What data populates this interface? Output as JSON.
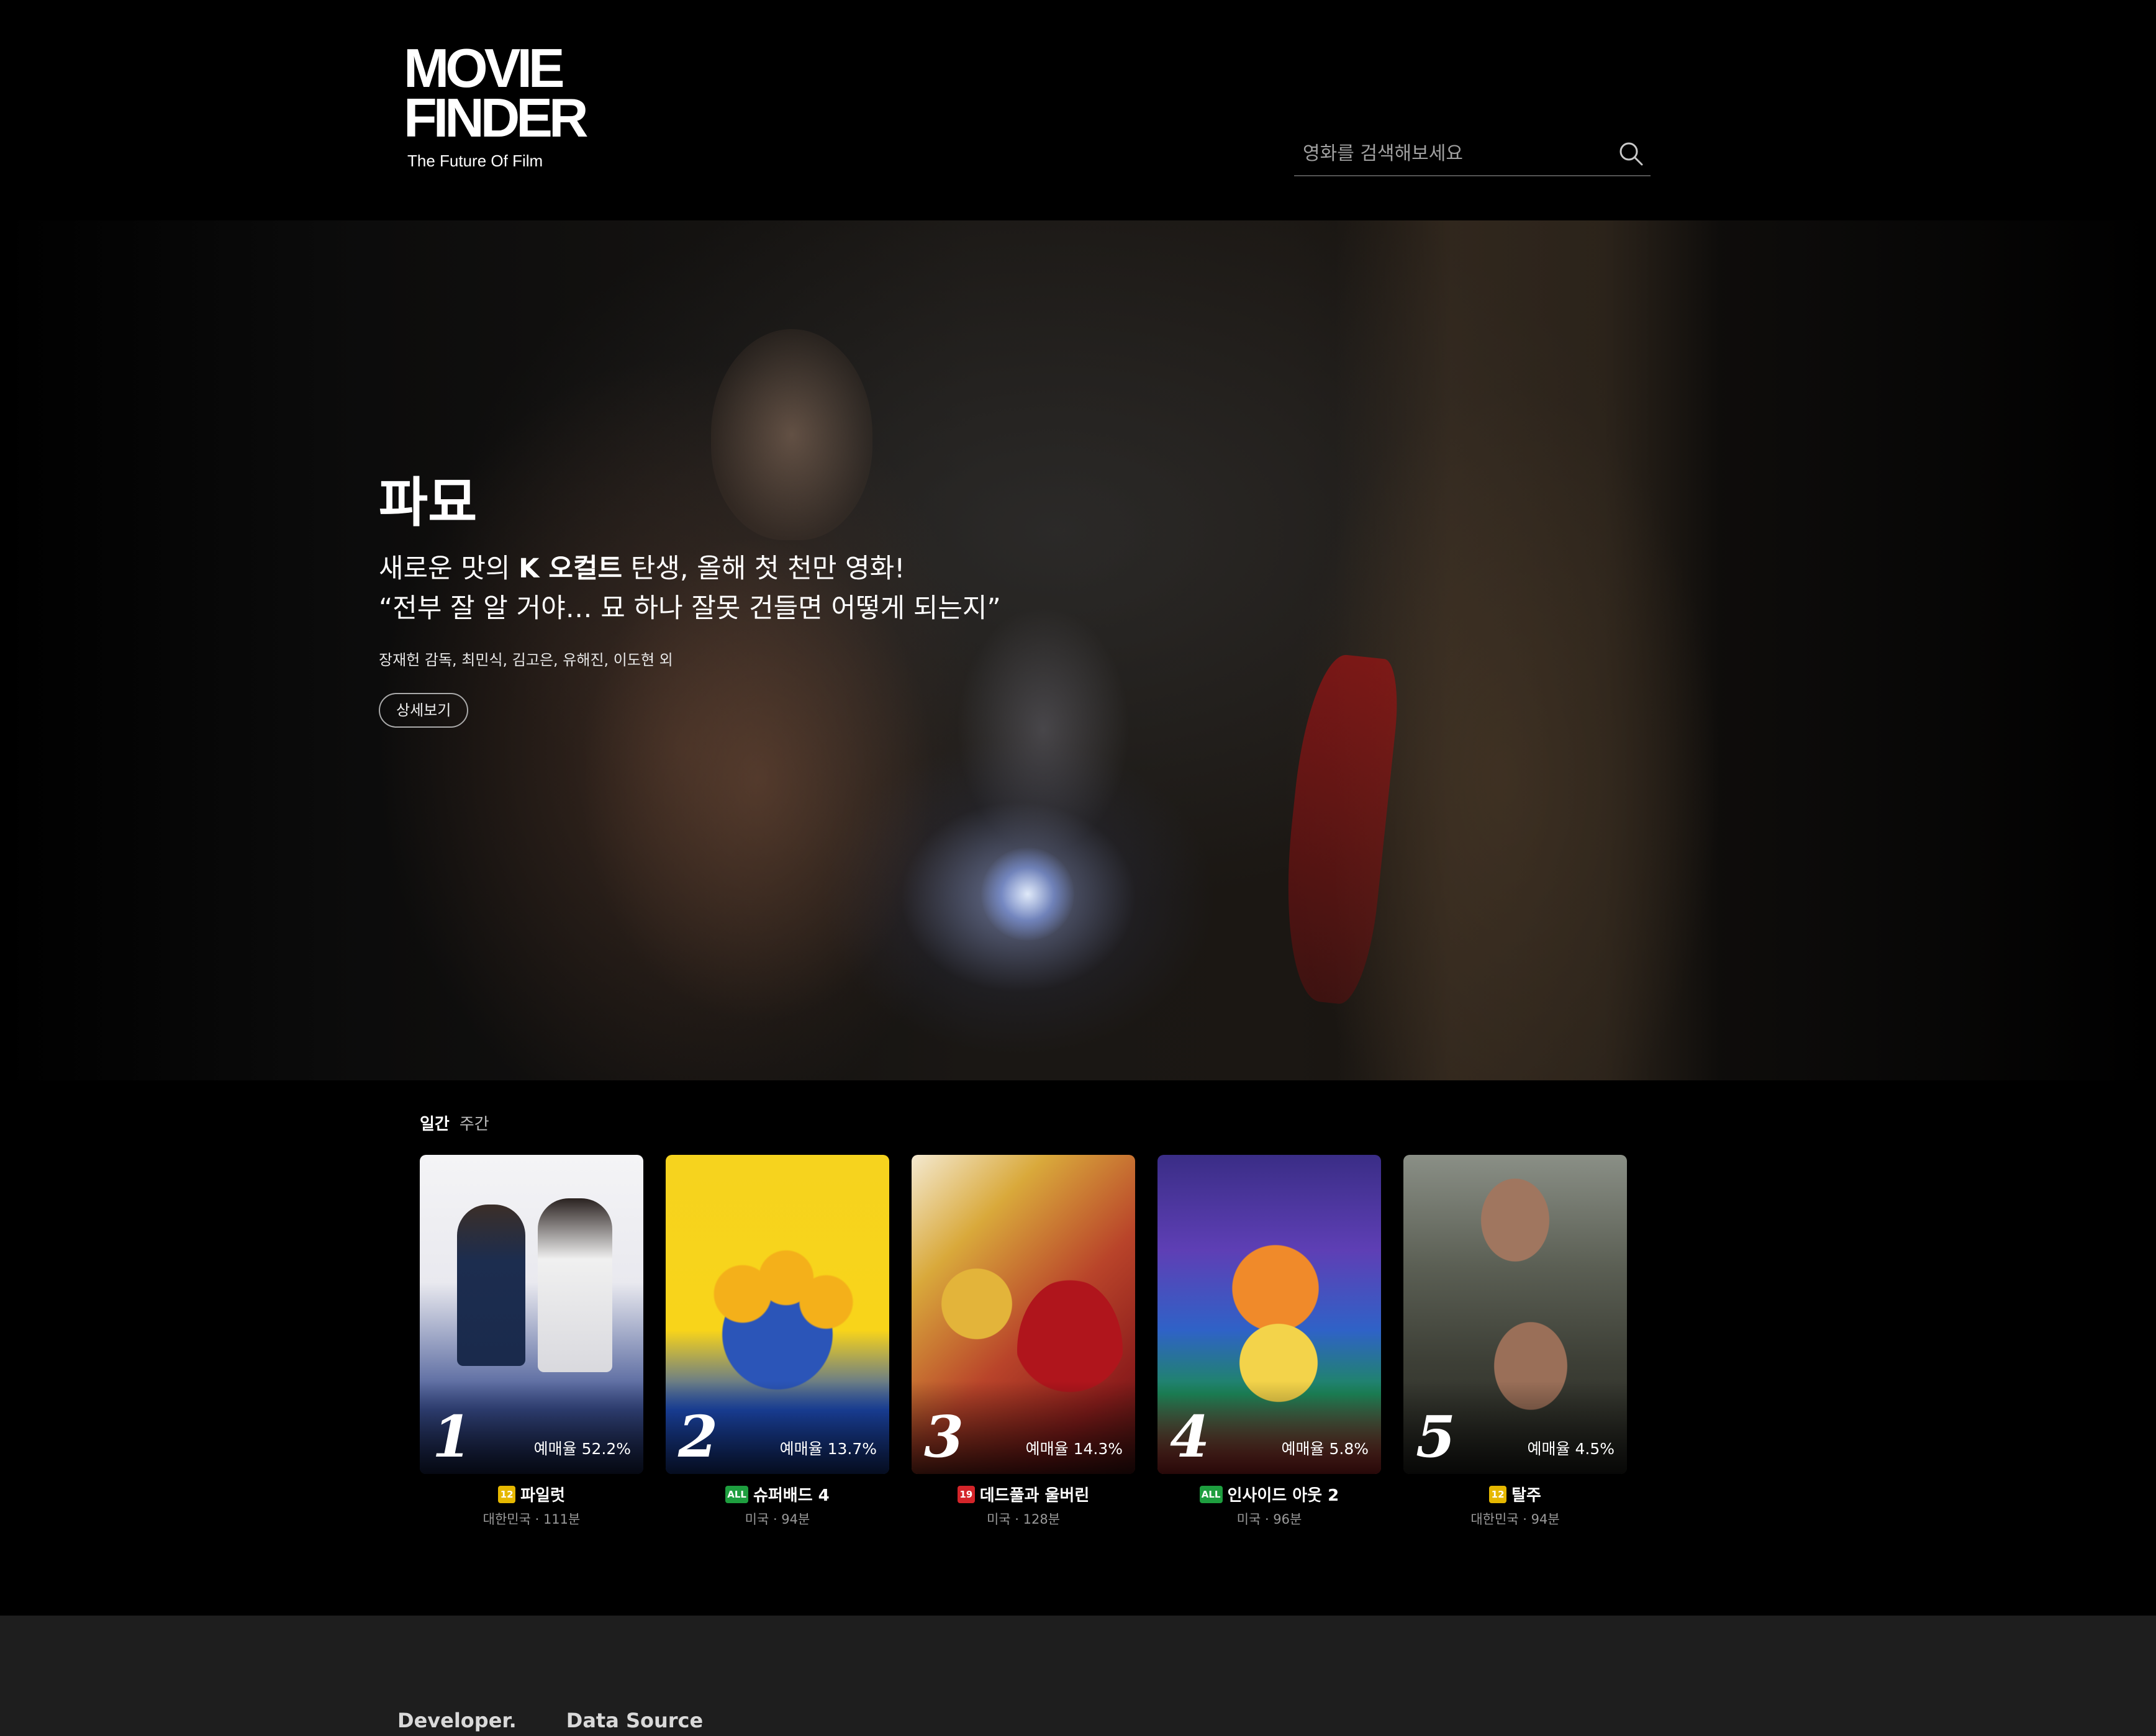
{
  "header": {
    "logo_title": "MOVIE\nFINDER",
    "logo_tagline": "The Future Of Film",
    "search": {
      "placeholder": "영화를 검색해보세요",
      "value": ""
    }
  },
  "hero": {
    "title": "파묘",
    "line1_pre": "새로운 맛의 ",
    "line1_bold": "K 오컬트",
    "line1_post": " 탄생, 올해 첫 천만 영화!",
    "line2": "“전부 잘 알 거야… 묘 하나 잘못 건들면 어떻게 되는지”",
    "credits": "장재헌 감독, 최민식, 김고은, 유해진, 이도현 외",
    "detail_button": "상세보기"
  },
  "ranking": {
    "tabs": [
      {
        "label": "일간",
        "active": true
      },
      {
        "label": "주간",
        "active": false
      }
    ],
    "movies": [
      {
        "rank": "1",
        "rate": "예매율 52.2%",
        "age": "12",
        "age_color": "#e6b800",
        "title": "파일럿",
        "meta": "대한민국 · 111분"
      },
      {
        "rank": "2",
        "rate": "예매율 13.7%",
        "age": "ALL",
        "age_color": "#1e9e3f",
        "title": "슈퍼배드 4",
        "meta": "미국 · 94분"
      },
      {
        "rank": "3",
        "rate": "예매율 14.3%",
        "age": "19",
        "age_color": "#d4252a",
        "title": "데드풀과 울버린",
        "meta": "미국 · 128분"
      },
      {
        "rank": "4",
        "rate": "예매율 5.8%",
        "age": "ALL",
        "age_color": "#1e9e3f",
        "title": "인사이드 아웃 2",
        "meta": "미국 · 96분"
      },
      {
        "rank": "5",
        "rate": "예매율 4.5%",
        "age": "12",
        "age_color": "#e6b800",
        "title": "탈주",
        "meta": "대한민국 · 94분"
      }
    ]
  },
  "footer": {
    "developer": "Developer.",
    "data_source": "Data Source"
  }
}
